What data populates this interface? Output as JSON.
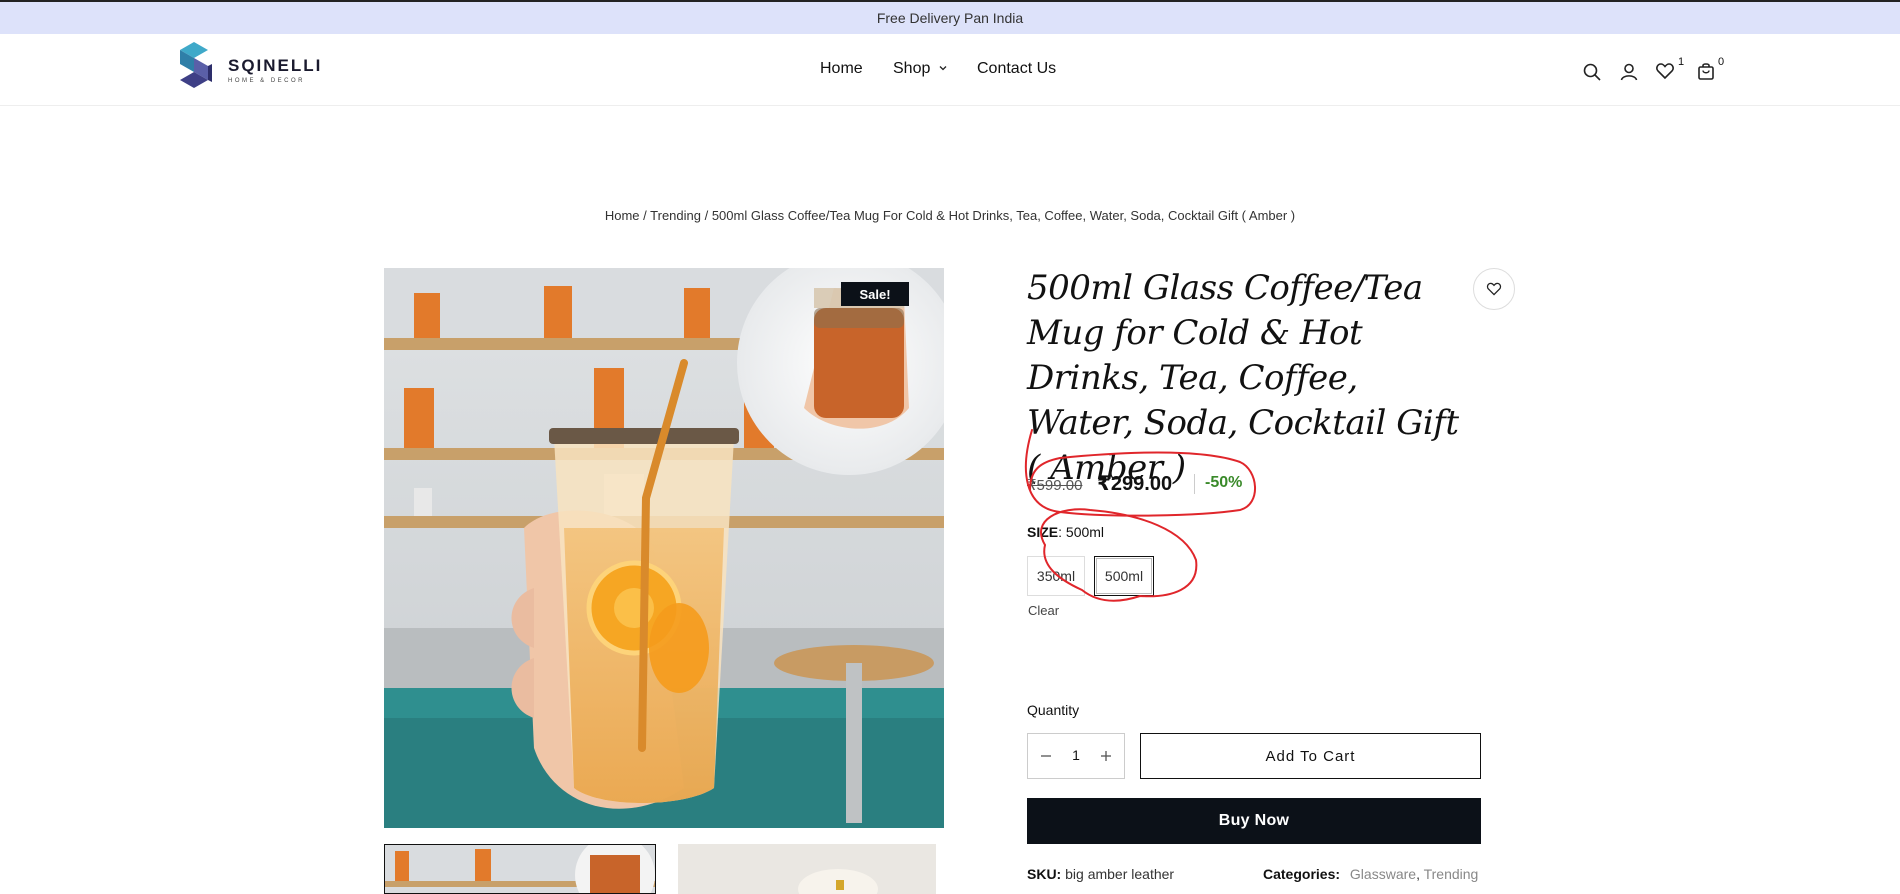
{
  "topbar": {
    "text": "Free Delivery Pan India"
  },
  "header": {
    "logo_word": "SQINELLI",
    "logo_sub": "HOME & DECOR",
    "nav": {
      "home": "Home",
      "shop": "Shop",
      "contact": "Contact Us"
    },
    "wishlist_count": "1",
    "cart_count": "0"
  },
  "breadcrumb": {
    "home": "Home",
    "sep1": " / ",
    "trending": "Trending",
    "sep2": " / ",
    "current": "500ml Glass Coffee/Tea Mug For Cold & Hot Drinks, Tea, Coffee, Water, Soda, Cocktail Gift ( Amber )"
  },
  "product": {
    "badge": "Sale!",
    "title": "500ml Glass Coffee/Tea Mug for Cold & Hot Drinks, Tea, Coffee, Water, Soda, Cocktail Gift ( Amber )",
    "old_price": "₹599.00",
    "new_price": "₹299.00",
    "discount": "-50%",
    "size_label": "SIZE",
    "size_selected": ": 500ml",
    "size_options": [
      "350ml",
      "500ml"
    ],
    "clear": "Clear",
    "quantity_label": "Quantity",
    "quantity": "1",
    "add_to_cart": "Add To Cart",
    "buy_now": "Buy Now",
    "sku_label": "SKU:",
    "sku": "big amber leather",
    "categories_label": "Categories:",
    "categories": [
      "Glassware",
      "Trending"
    ],
    "categories_sep": ","
  },
  "colors": {
    "topbar_bg": "#dde2fa",
    "buy_now_bg": "#0c1118",
    "discount": "#3a8a2a",
    "annotation": "#e0262b"
  },
  "icons": [
    "search-icon",
    "user-icon",
    "heart-icon",
    "cart-icon",
    "chevron-down-icon",
    "minus-icon",
    "plus-icon"
  ]
}
